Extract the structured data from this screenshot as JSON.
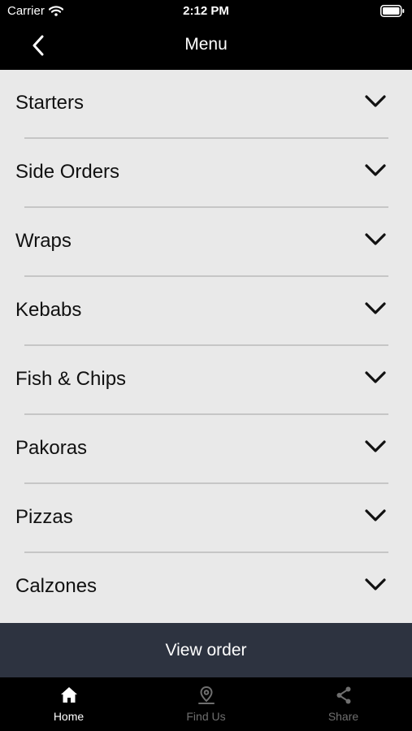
{
  "status_bar": {
    "carrier": "Carrier",
    "time": "2:12 PM"
  },
  "header": {
    "title": "Menu"
  },
  "menu": {
    "items": [
      {
        "label": "Starters"
      },
      {
        "label": "Side Orders"
      },
      {
        "label": "Wraps"
      },
      {
        "label": "Kebabs"
      },
      {
        "label": "Fish & Chips"
      },
      {
        "label": "Pakoras"
      },
      {
        "label": "Pizzas"
      },
      {
        "label": "Calzones"
      }
    ]
  },
  "view_order": {
    "label": "View order"
  },
  "tabs": [
    {
      "label": "Home",
      "icon": "home-icon",
      "active": true
    },
    {
      "label": "Find Us",
      "icon": "location-pin-icon",
      "active": false
    },
    {
      "label": "Share",
      "icon": "share-icon",
      "active": false
    }
  ],
  "colors": {
    "header_bg": "#000000",
    "list_bg": "#e9e9e9",
    "view_order_bg": "#2d3340",
    "tab_inactive": "#6f6f6f"
  }
}
